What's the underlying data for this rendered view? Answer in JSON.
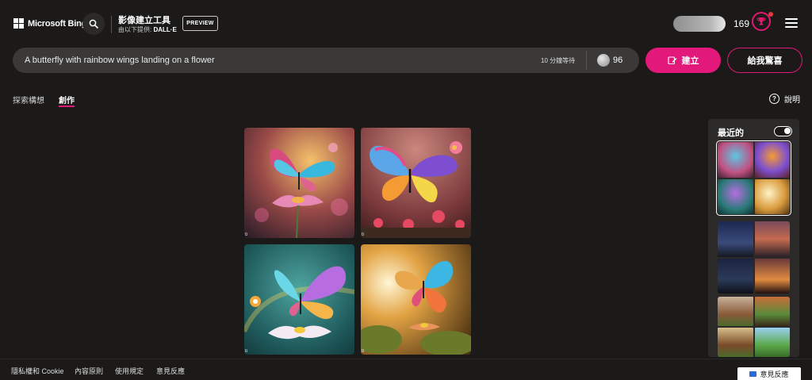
{
  "header": {
    "brand": "Microsoft Bing",
    "app_title": "影像建立工具",
    "provided_by": "由以下提供:",
    "provider": "DALL·E",
    "preview_badge": "PREVIEW",
    "points": "169"
  },
  "prompt": {
    "text": "A butterfly with rainbow wings landing on a flower",
    "wait": "10 分鐘等待",
    "boosts": "96",
    "create_label": "建立",
    "surprise_label": "給我驚喜"
  },
  "tabs": [
    {
      "label": "探索構想",
      "active": false
    },
    {
      "label": "創作",
      "active": true
    }
  ],
  "help_label": "說明",
  "images": [
    {
      "alt": "butterfly image 1",
      "mark": "b"
    },
    {
      "alt": "butterfly image 2",
      "mark": "b"
    },
    {
      "alt": "butterfly image 3",
      "mark": "b"
    },
    {
      "alt": "butterfly image 4",
      "mark": "b"
    }
  ],
  "recent": {
    "title": "最近的",
    "toggle_on": true
  },
  "footer": {
    "links": [
      "隱私權和 Cookie",
      "內容原則",
      "使用規定",
      "意見反應"
    ],
    "feedback_button": "意見反應"
  },
  "colors": {
    "accent": "#e2187a",
    "background": "#1b1a19",
    "surface": "#3a3938"
  }
}
